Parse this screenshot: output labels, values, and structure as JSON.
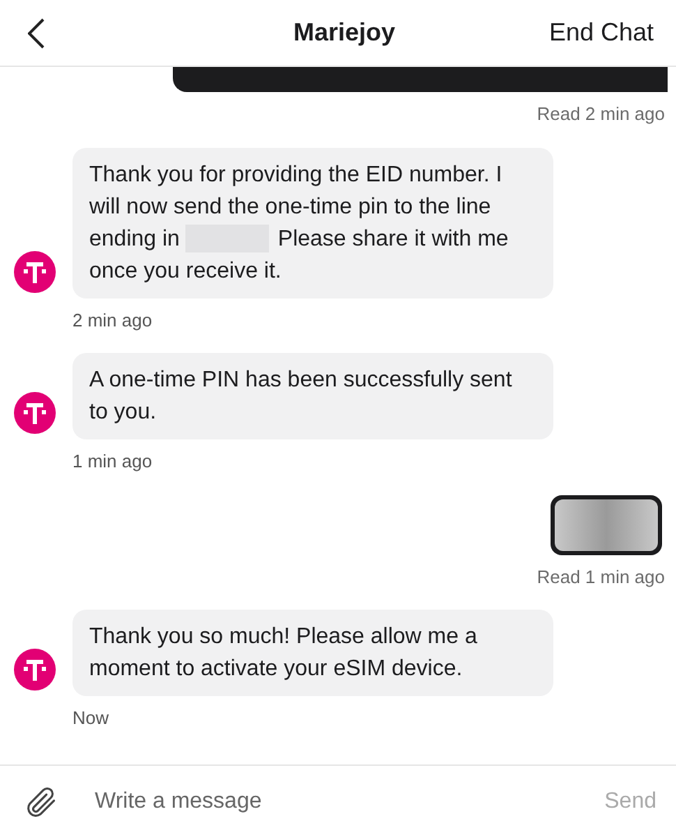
{
  "header": {
    "title": "Mariejoy",
    "action": "End Chat"
  },
  "messages": [
    {
      "kind": "clipped",
      "status": "Read 2 min ago"
    },
    {
      "kind": "incoming",
      "segments": [
        {
          "kind": "text",
          "text": "Thank you for providing the EID number. I will now send the one-time pin to the line ending in"
        },
        {
          "kind": "redacted"
        },
        {
          "kind": "text",
          "text": "Please share it with me once you receive it."
        }
      ],
      "time": "2 min ago"
    },
    {
      "kind": "incoming",
      "segments": [
        {
          "kind": "text",
          "text": "A one-time PIN has been successfully sent to you."
        }
      ],
      "time": "1 min ago"
    },
    {
      "kind": "blurred",
      "status": "Read 1 min ago"
    },
    {
      "kind": "incoming",
      "segments": [
        {
          "kind": "text",
          "text": "Thank you so much! Please allow me a moment to activate your eSIM device."
        }
      ],
      "time": "Now"
    }
  ],
  "composer": {
    "placeholder": "Write a message",
    "send": "Send"
  }
}
